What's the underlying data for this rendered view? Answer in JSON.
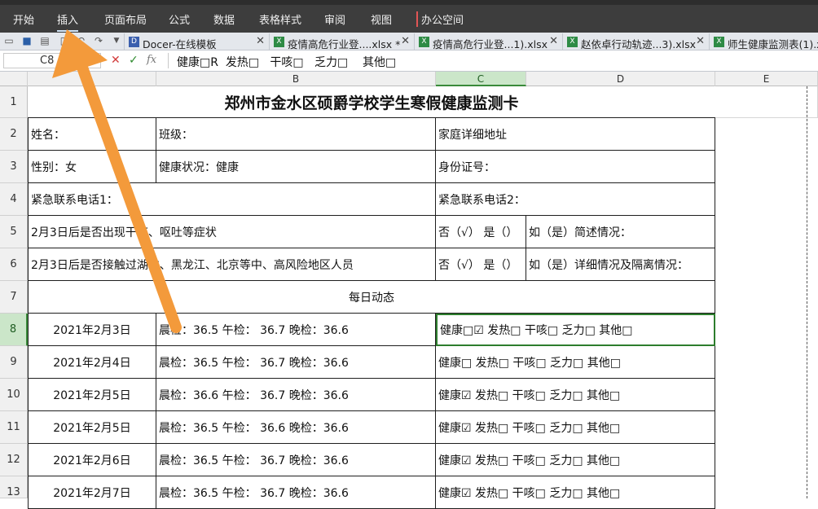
{
  "menubar": {
    "items": [
      "开始",
      "插入",
      "页面布局",
      "公式",
      "数据",
      "表格样式",
      "审阅",
      "视图",
      "办公空间"
    ],
    "active": "插入"
  },
  "tabs": [
    {
      "label": "Docer-在线模板",
      "icon": "docer-icon"
    },
    {
      "label": "疫情高危行业登....xlsx *",
      "icon": "excel-icon"
    },
    {
      "label": "疫情高危行业登...1).xlsx",
      "icon": "excel-icon"
    },
    {
      "label": "赵依卓行动轨迹...3).xlsx",
      "icon": "excel-icon"
    },
    {
      "label": "师生健康监测表(1).xl",
      "icon": "excel-icon"
    }
  ],
  "formula_bar": {
    "name_box": "C8",
    "fx_label": "fx",
    "value": "健康□R  发热□   干咳□   乏力□    其他□"
  },
  "columns": [
    "B",
    "C",
    "D",
    "E"
  ],
  "rows": [
    "1",
    "2",
    "3",
    "4",
    "5",
    "6",
    "7",
    "8",
    "9",
    "10",
    "11",
    "12",
    "13"
  ],
  "sheet": {
    "title": "郑州市金水区硕爵学校学生寒假健康监测卡",
    "name_label": "姓名：",
    "class_label": "班级：",
    "address_label": "家庭详细地址",
    "gender_label": "性别：女",
    "health_label": "健康状况：健康",
    "id_label": "身份证号：",
    "phone1_label": "紧急联系电话1：",
    "phone2_label": "紧急联系电话2：",
    "q1": "2月3日后是否出现干咳、呕吐等症状",
    "q1_answer": "否（√） 是（）",
    "q1_detail": "如（是）简述情况：",
    "q2": "2月3日后是否接触过湖北、黑龙江、北京等中、高风险地区人员",
    "q2_answer": "否（√） 是（）",
    "q2_detail": "如（是）详细情况及隔离情况：",
    "daily_header": "每日动态",
    "daily": [
      {
        "date": "2021年2月3日",
        "temps": "晨检：36.5      午检： 36.7      晚检：36.6",
        "symptoms": "健康□☑   发热□    干咳□    乏力□     其他□"
      },
      {
        "date": "2021年2月4日",
        "temps": "晨检：36.5      午检： 36.7      晚检：36.6",
        "symptoms": "健康□   发热□    干咳□    乏力□     其他□"
      },
      {
        "date": "2021年2月5日",
        "temps": "晨检：36.6      午检： 36.7      晚检：36.6",
        "symptoms": "健康☑   发热□    干咳□    乏力□     其他□"
      },
      {
        "date": "2021年2月5日",
        "temps": "晨检：36.5      午检： 36.6      晚检：36.6",
        "symptoms": "健康☑   发热□    干咳□    乏力□     其他□"
      },
      {
        "date": "2021年2月6日",
        "temps": "晨检：36.5      午检： 36.7      晚检：36.6",
        "symptoms": "健康☑   发热□    干咳□    乏力□     其他□"
      },
      {
        "date": "2021年2月7日",
        "temps": "晨检：36.5      午检： 36.7      晚检：36.6",
        "symptoms": "健康☑   发热□    干咳□    乏力□     其他□"
      }
    ]
  },
  "colors": {
    "menubar_bg": "#3d3d3d",
    "selection_green": "#2d7d2d",
    "arrow_orange": "#f39a3b"
  }
}
